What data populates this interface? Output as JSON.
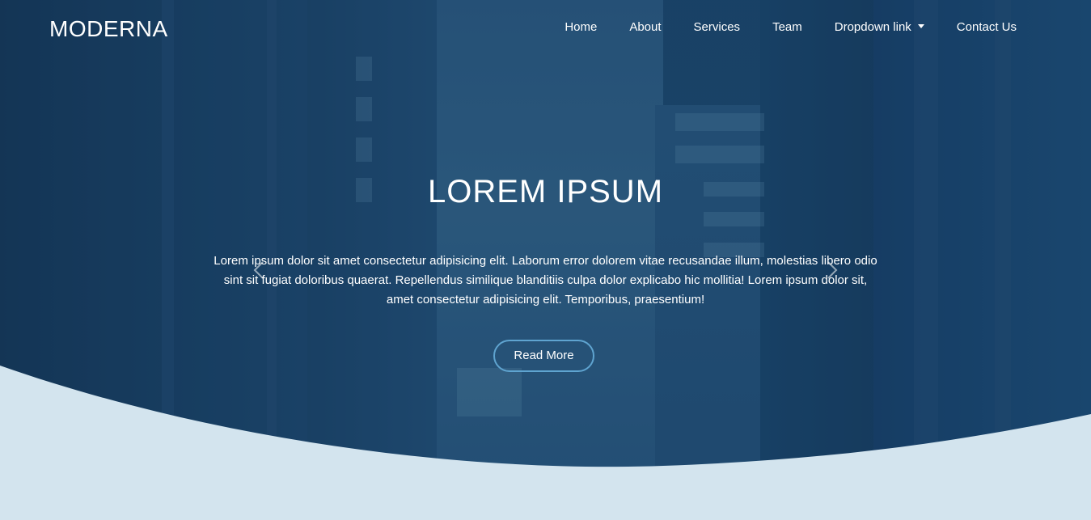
{
  "brand": {
    "name": "MODERNA"
  },
  "nav": {
    "items": [
      {
        "label": "Home"
      },
      {
        "label": "About"
      },
      {
        "label": "Services"
      },
      {
        "label": "Team"
      },
      {
        "label": "Dropdown link"
      },
      {
        "label": "Contact Us"
      }
    ]
  },
  "hero": {
    "title": "LOREM IPSUM",
    "text": "Lorem ipsum dolor sit amet consectetur adipisicing elit. Laborum error dolorem vitae recusandae illum, molestias libero odio sint sit fugiat doloribus quaerat. Repellendus similique blanditiis culpa dolor explicabo hic mollitia! Lorem ipsum dolor sit, amet consectetur adipisicing elit. Temporibus, praesentium!",
    "button_label": "Read More"
  },
  "colors": {
    "hero_overlay": "#1d4a70",
    "wave": "#d3e4ee",
    "button_border": "#5fa4d0",
    "text": "#ffffff"
  },
  "icons": {
    "prev": "chevron-left-icon",
    "next": "chevron-right-icon",
    "dropdown": "caret-down-icon"
  }
}
